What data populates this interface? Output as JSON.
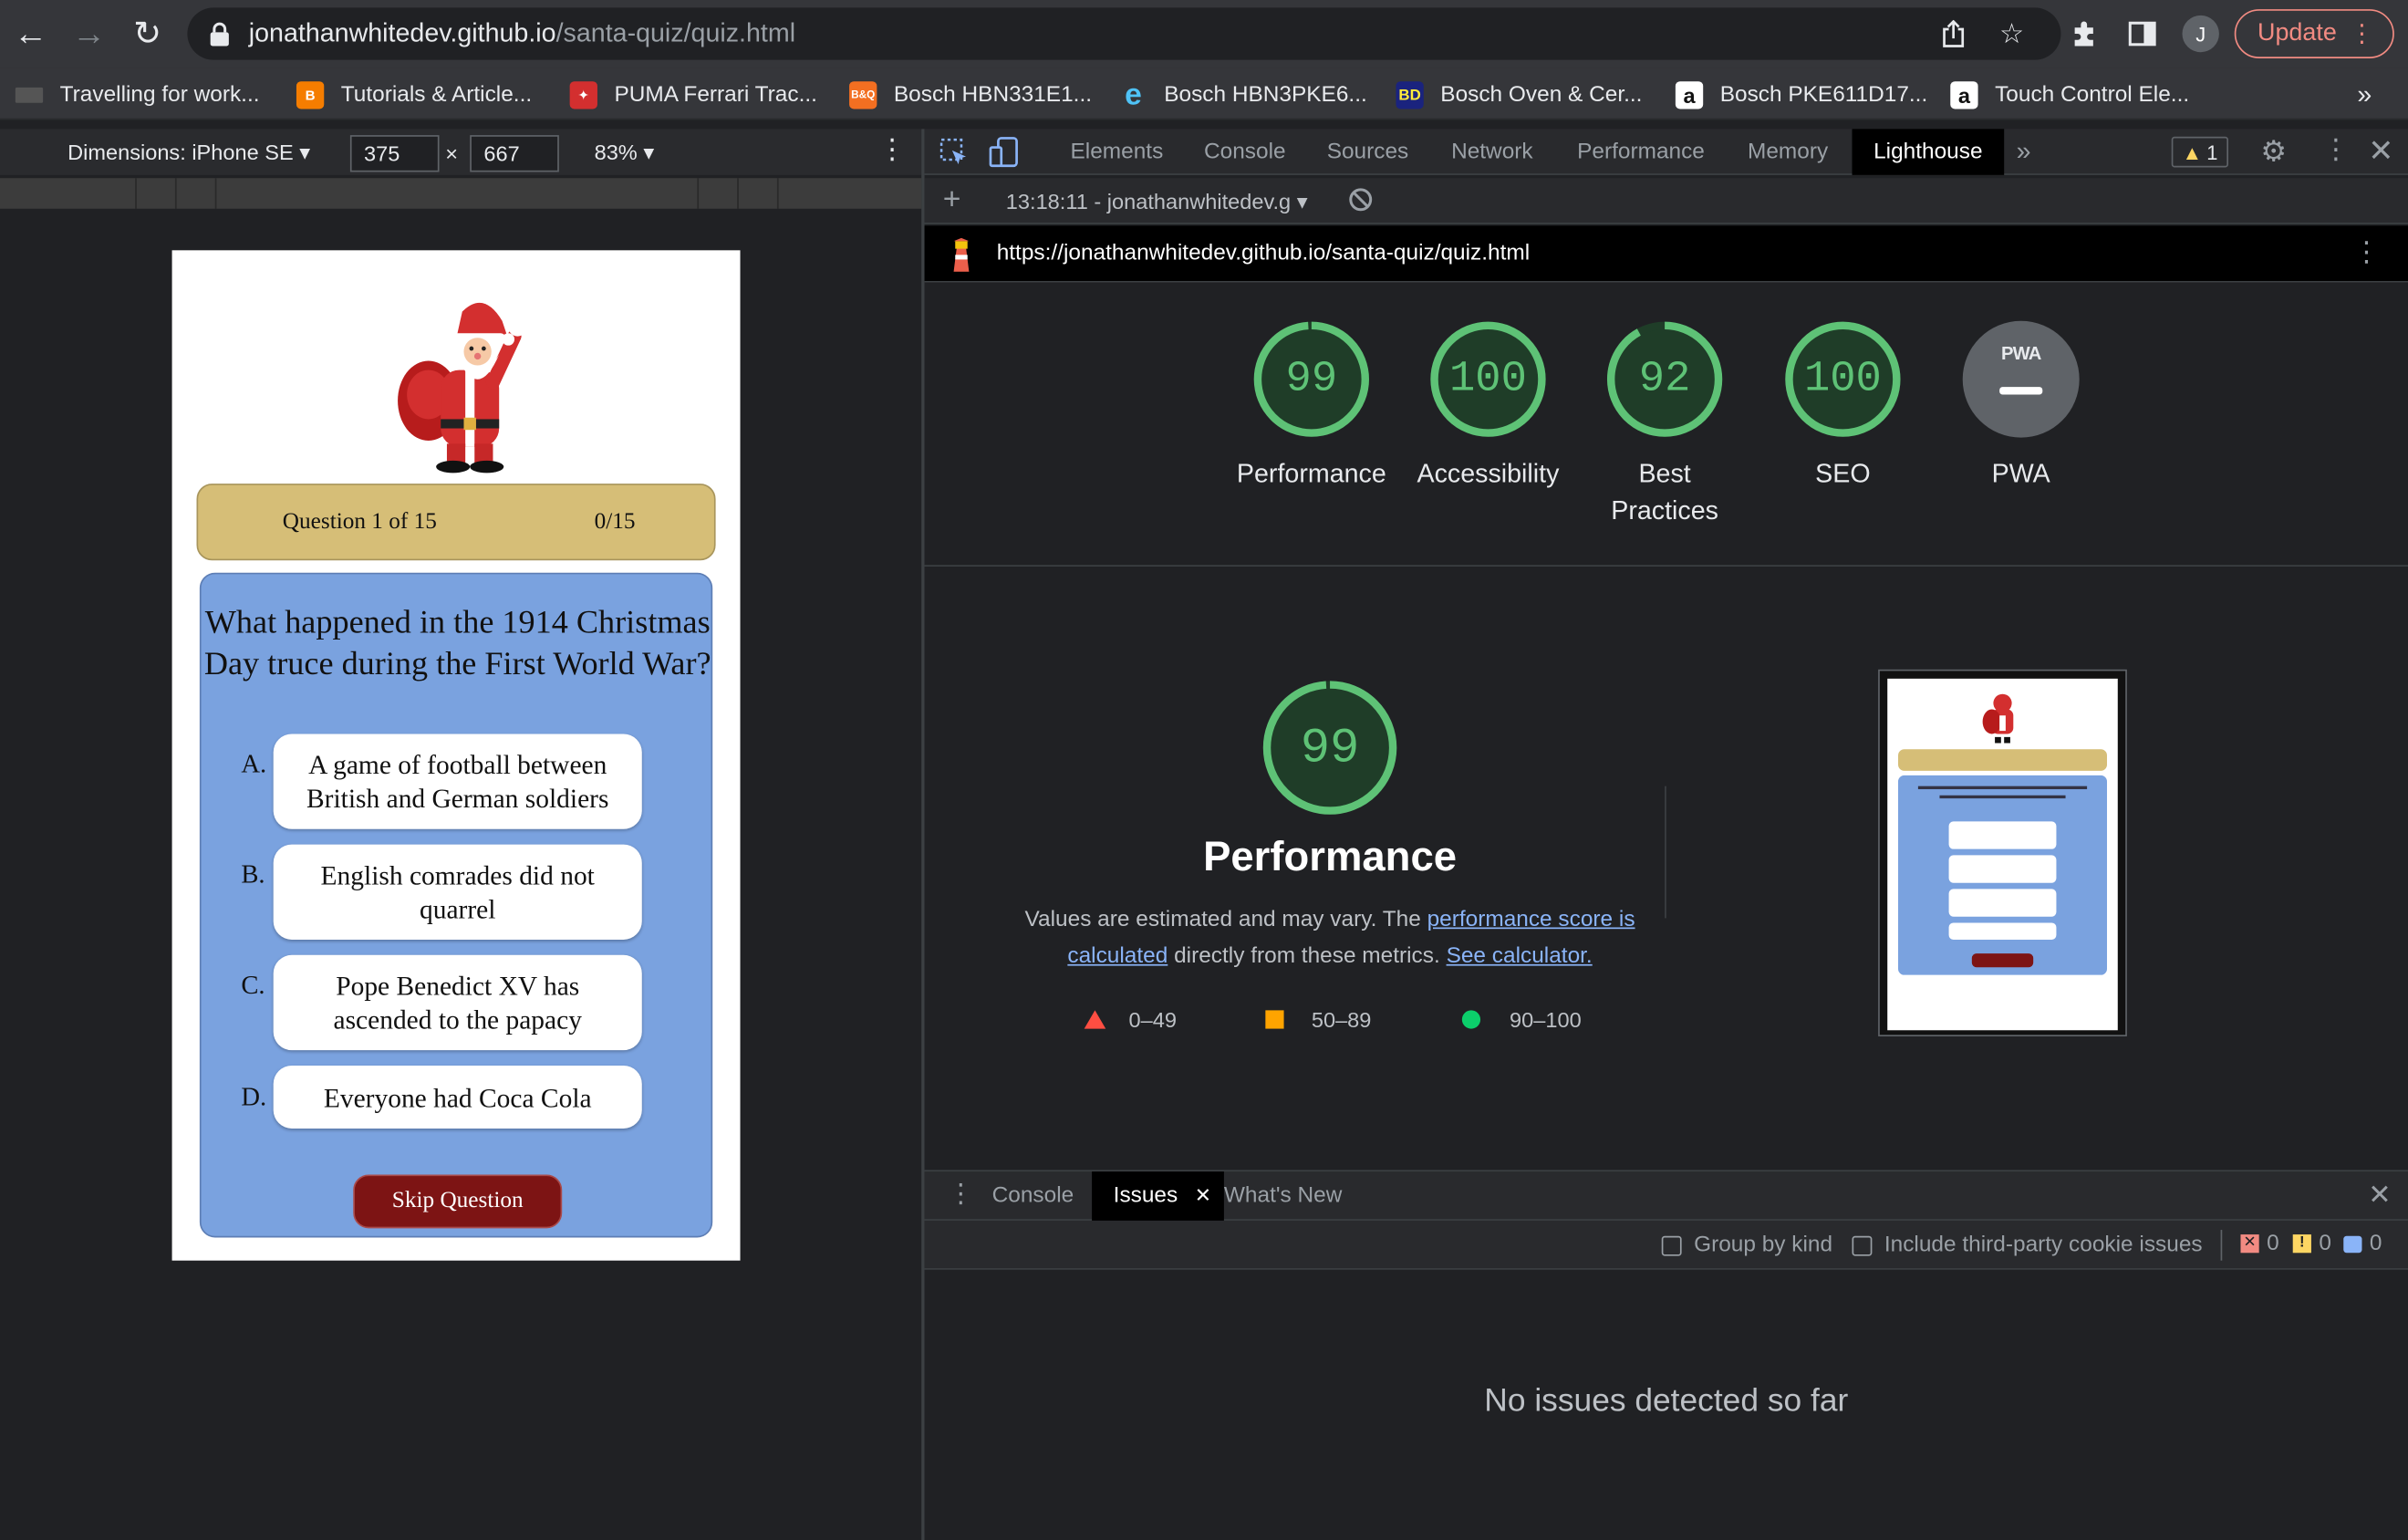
{
  "browser": {
    "address_host": "jonathanwhitedev.github.io",
    "address_path": "/santa-quiz/quiz.html",
    "profile_initial": "J",
    "update_label": "Update",
    "bookmarks": [
      {
        "label": "Travelling for work...",
        "icon": "generic-favicon",
        "color": "#555555"
      },
      {
        "label": "Tutorials & Article...",
        "icon": "blogger-icon",
        "color": "#f57d00"
      },
      {
        "label": "PUMA Ferrari Trac...",
        "icon": "puma-icon",
        "color": "#d32f2f"
      },
      {
        "label": "Bosch HBN331E1...",
        "icon": "bq-icon",
        "color": "#f36f21"
      },
      {
        "label": "Bosch HBN3PKE6...",
        "icon": "edge-icon",
        "color": "#1e88e5"
      },
      {
        "label": "Bosch Oven & Cer...",
        "icon": "bd-icon",
        "color": "#1a237e"
      },
      {
        "label": "Bosch PKE611D17...",
        "icon": "amazon-icon",
        "color": "#ffffff"
      },
      {
        "label": "Touch Control Ele...",
        "icon": "amazon-icon",
        "color": "#ffffff"
      }
    ],
    "bookmark_overflow": "»"
  },
  "device_toolbar": {
    "dimensions_label": "Dimensions: iPhone SE",
    "width": "375",
    "times": "×",
    "height": "667",
    "zoom": "83%"
  },
  "quiz": {
    "question_counter": "Question 1 of 15",
    "score": "0/15",
    "question": "What happened in the 1914 Christmas Day truce during the First World War?",
    "options": [
      {
        "letter": "A.",
        "text": "A game of football between British and German soldiers"
      },
      {
        "letter": "B.",
        "text": "English comrades did not quarrel"
      },
      {
        "letter": "C.",
        "text": "Pope Benedict XV has ascended to the papacy"
      },
      {
        "letter": "D.",
        "text": "Everyone had Coca Cola"
      }
    ],
    "skip_label": "Skip Question"
  },
  "devtools": {
    "tabs": [
      "Elements",
      "Console",
      "Sources",
      "Network",
      "Performance",
      "Memory",
      "Lighthouse"
    ],
    "active_tab": "Lighthouse",
    "more_tabs": "»",
    "warning_count": "1",
    "report_selector": "13:18:11 - jonathanwhitedev.g",
    "report_url": "https://jonathanwhitedev.github.io/santa-quiz/quiz.html"
  },
  "lighthouse": {
    "categories": [
      {
        "score": 99,
        "label": "Performance"
      },
      {
        "score": 100,
        "label": "Accessibility"
      },
      {
        "score": 92,
        "label": "Best Practices"
      },
      {
        "score": 100,
        "label": "SEO"
      }
    ],
    "pwa_badge": "PWA",
    "pwa_label": "PWA",
    "perf_score": 99,
    "perf_title": "Performance",
    "perf_desc_1": "Values are estimated and may vary. The",
    "perf_link_1": "performance score is calculated",
    "perf_desc_2": "directly from these metrics.",
    "perf_link_2": "See calculator.",
    "legend": [
      {
        "range": "0–49",
        "color": "#ff4e42"
      },
      {
        "range": "50–89",
        "color": "#ffa400"
      },
      {
        "range": "90–100",
        "color": "#0cce6b"
      }
    ],
    "colors": {
      "pass": "#5ec276",
      "pass_track": "#1f3d28"
    }
  },
  "drawer": {
    "tabs": [
      "Console",
      "Issues",
      "What's New"
    ],
    "active_tab": "Issues",
    "group_by_kind": "Group by kind",
    "third_party": "Include third-party cookie issues",
    "error_count": "0",
    "warning_count": "0",
    "info_count": "0",
    "empty_message": "No issues detected so far"
  }
}
